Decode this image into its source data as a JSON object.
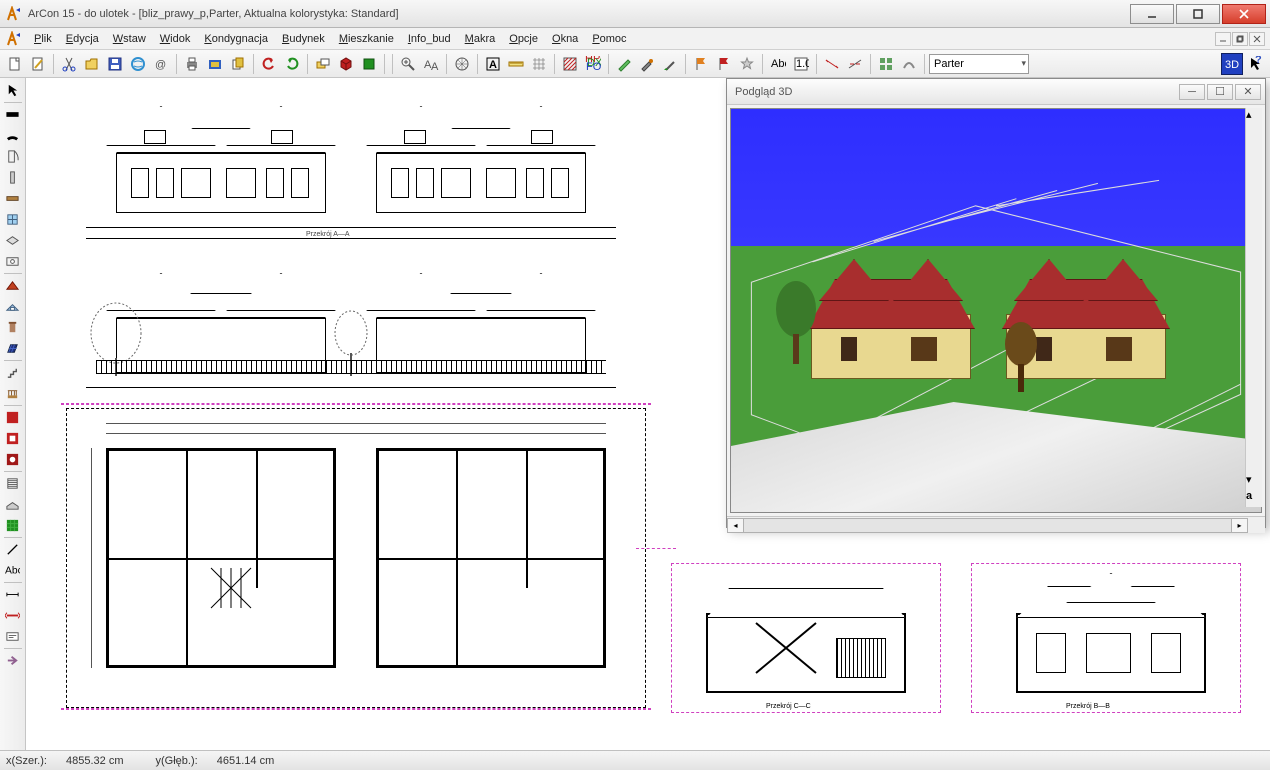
{
  "window": {
    "title": "ArCon 15 - do ulotek - [bliz_prawy_p,Parter, Aktualna kolorystyka: Standard]"
  },
  "menu": {
    "items": [
      {
        "label": "Plik",
        "ul": "P"
      },
      {
        "label": "Edycja",
        "ul": "E"
      },
      {
        "label": "Wstaw",
        "ul": "W"
      },
      {
        "label": "Widok",
        "ul": "W"
      },
      {
        "label": "Kondygnacja",
        "ul": "K"
      },
      {
        "label": "Budynek",
        "ul": "B"
      },
      {
        "label": "Mieszkanie",
        "ul": "M"
      },
      {
        "label": "Info_bud",
        "ul": "I"
      },
      {
        "label": "Makra",
        "ul": "M"
      },
      {
        "label": "Opcje",
        "ul": "O"
      },
      {
        "label": "Okna",
        "ul": "O"
      },
      {
        "label": "Pomoc",
        "ul": "P"
      }
    ]
  },
  "toolbar_top": {
    "floor_combo": "Parter"
  },
  "preview3d": {
    "title": "Podgląd 3D"
  },
  "statusbar": {
    "x_label": "x(Szer.):",
    "x_value": "4855.32 cm",
    "y_label": "y(Głęb.):",
    "y_value": "4651.14 cm"
  },
  "labels": {
    "przekroj_a": "Przekrój A—A",
    "przekroj_b": "Przekrój B—B",
    "przekroj_c": "Przekrój C—C"
  }
}
